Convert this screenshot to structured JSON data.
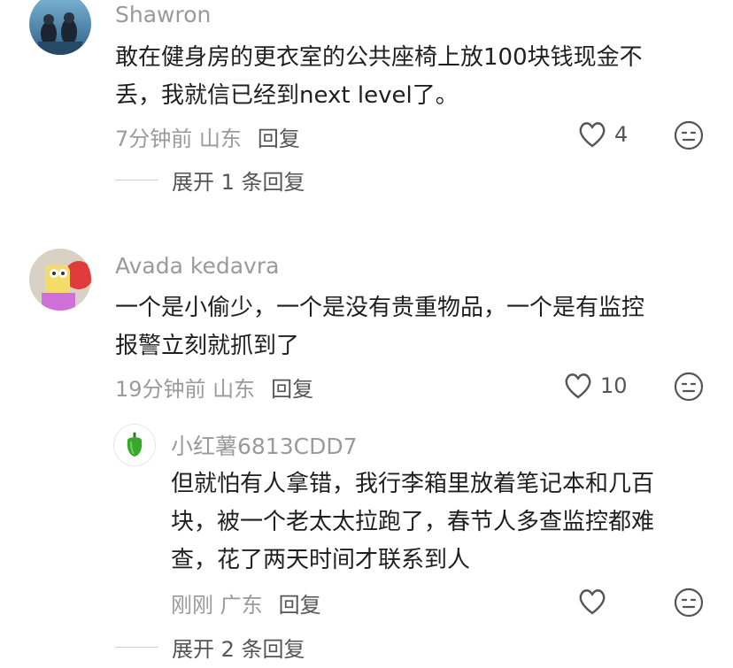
{
  "comments": [
    {
      "name": "Shawron",
      "line1": "敢在健身房的更衣室的公共座椅上放100块钱现金不",
      "line2": "丢，我就信已经到next level了。",
      "time": "7分钟前 山东",
      "reply_label": "回复",
      "likes": "4",
      "expand": "展开 1 条回复"
    },
    {
      "name": "Avada kedavra",
      "line1": "一个是小偷少，一个是没有贵重物品，一个是有监控",
      "line2": "报警立刻就抓到了",
      "time": "19分钟前 山东",
      "reply_label": "回复",
      "likes": "10"
    }
  ],
  "reply": {
    "name": "小红薯6813CDD7",
    "line1": "但就怕有人拿错，我行李箱里放着笔记本和几百",
    "line2": "块，被一个老太太拉跑了，春节人多查监控都难",
    "line3": "查，花了两天时间才联系到人",
    "time": "刚刚 广东",
    "reply_label": "回复",
    "expand": "展开 2 条回复"
  },
  "icons": {
    "like": "heart-icon",
    "dislike": "neutral-face-icon",
    "avatar_3": "green-pepper-icon"
  },
  "colors": {
    "meta": "#9a9a9a",
    "text": "#1f1f1f",
    "pepper": "#3aa82f"
  }
}
